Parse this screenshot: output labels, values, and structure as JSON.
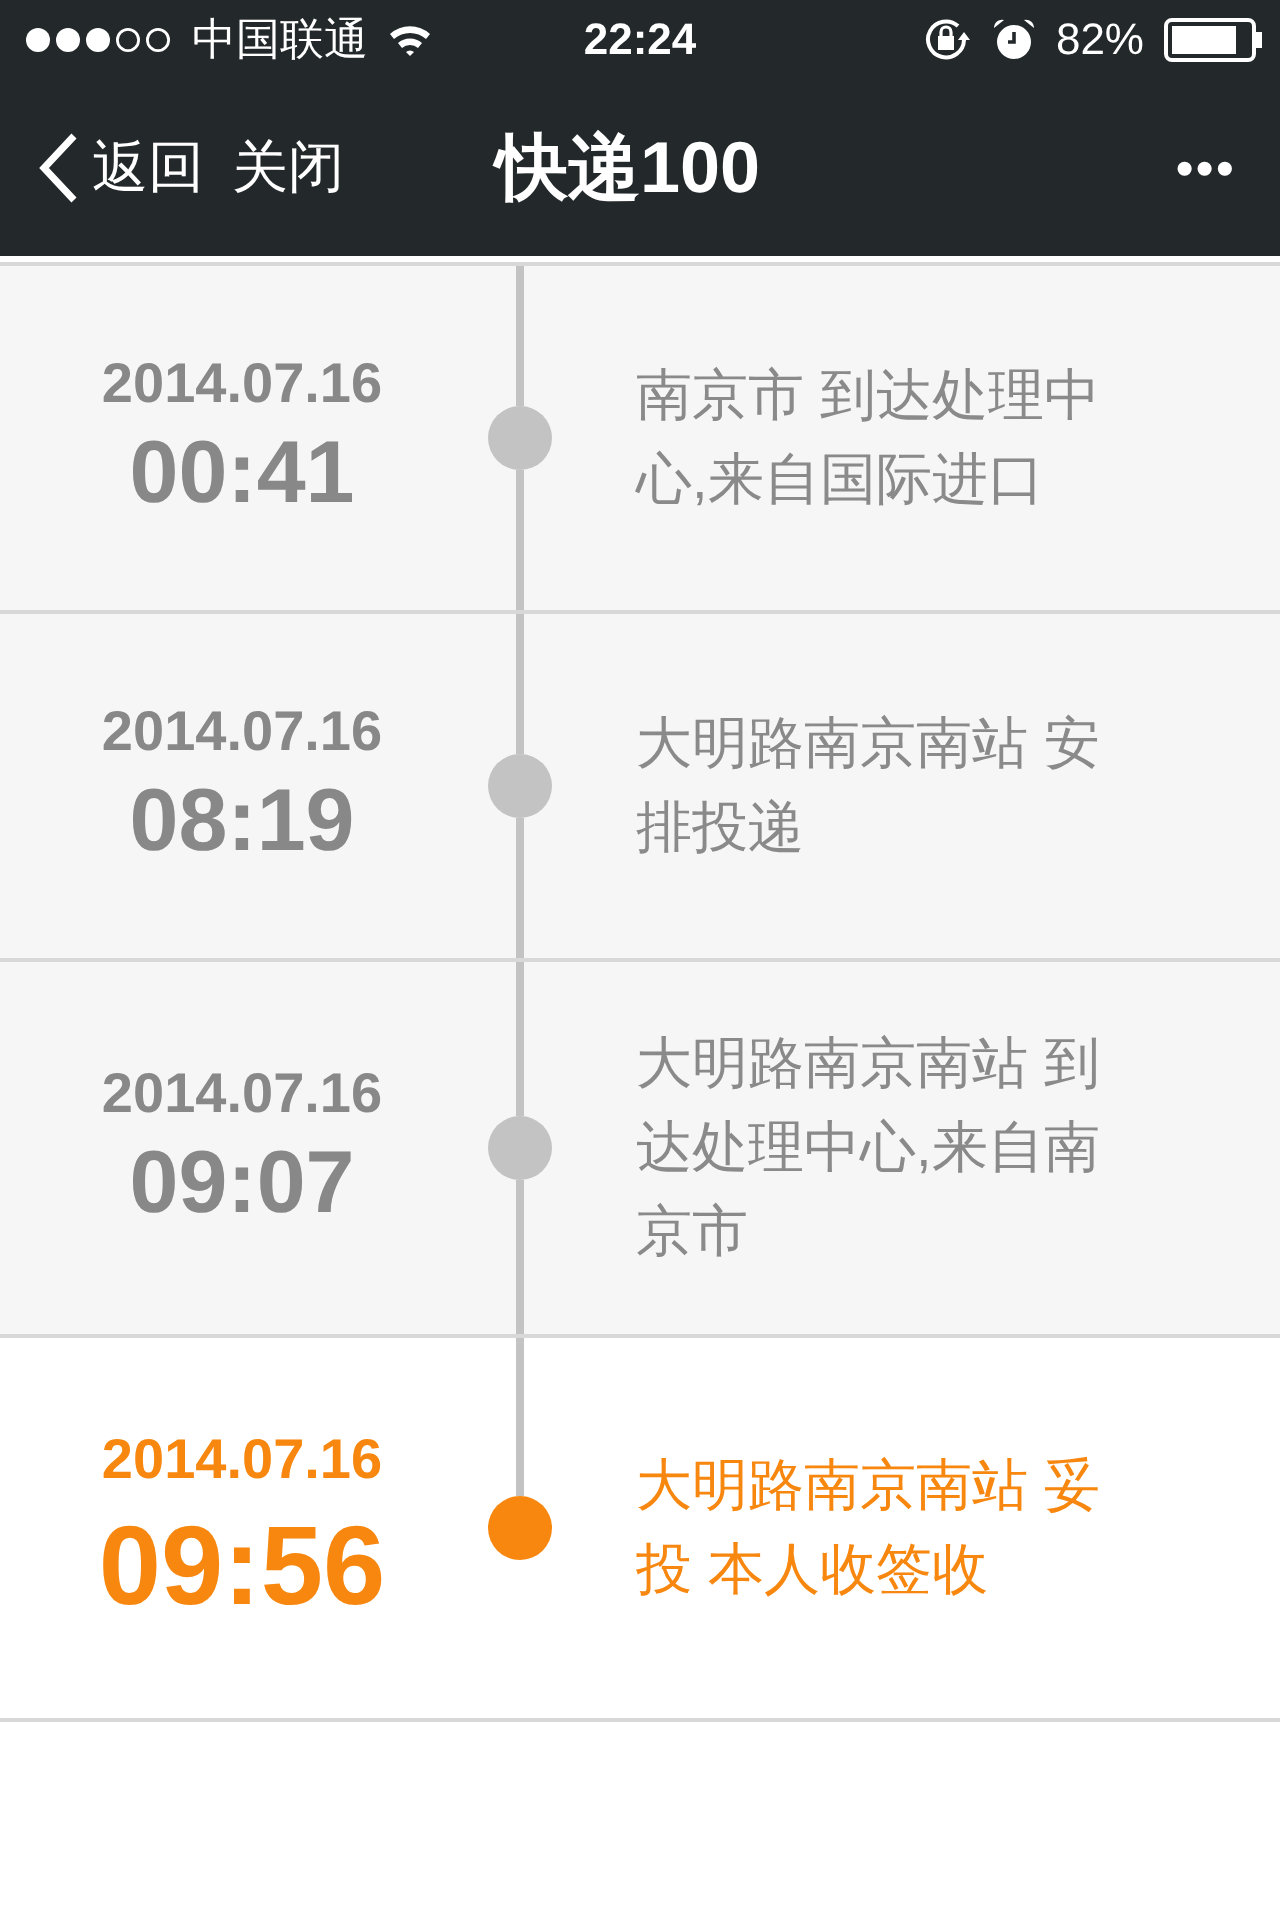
{
  "status_bar": {
    "carrier": "中国联通",
    "time": "22:24",
    "battery": "82%"
  },
  "nav": {
    "back": "返回",
    "close": "关闭",
    "title": "快递100",
    "more": "•••"
  },
  "events": [
    {
      "date": "2014.07.16",
      "time": "00:41",
      "text": "南京市 到达处理中心,来自国际进口",
      "current": false
    },
    {
      "date": "2014.07.16",
      "time": "08:19",
      "text": "大明路南京南站 安排投递",
      "current": false
    },
    {
      "date": "2014.07.16",
      "time": "09:07",
      "text": "大明路南京南站 到达处理中心,来自南京市",
      "current": false
    },
    {
      "date": "2014.07.16",
      "time": "09:56",
      "text": "大明路南京南站 妥投 本人收签收",
      "current": true
    }
  ]
}
